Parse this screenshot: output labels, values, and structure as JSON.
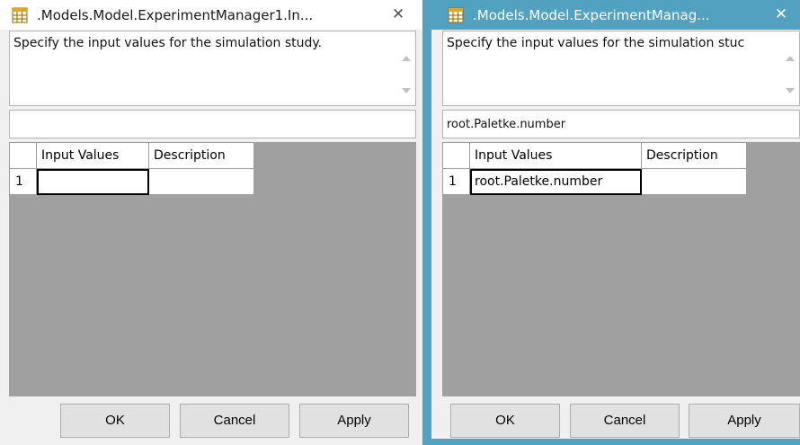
{
  "left_dialog": {
    "title": ".Models.Model.ExperimentManager1.In...",
    "description": "Specify the input values for the simulation study.",
    "input_value": "",
    "grid": {
      "headers": [
        "Input Values",
        "Description"
      ],
      "rows": [
        {
          "num": "1",
          "input_value": "",
          "description": ""
        }
      ]
    },
    "buttons": {
      "ok": "OK",
      "cancel": "Cancel",
      "apply": "Apply"
    }
  },
  "right_dialog": {
    "title": ".Models.Model.ExperimentManag...",
    "description": "Specify the input values for the simulation stuc",
    "input_value": "root.Paletke.number",
    "grid": {
      "headers": [
        "Input Values",
        "Description"
      ],
      "rows": [
        {
          "num": "1",
          "input_value": "root.Paletke.number",
          "description": ""
        }
      ]
    },
    "buttons": {
      "ok": "OK",
      "cancel": "Cancel",
      "apply": "Apply"
    }
  },
  "icons": {
    "app_icon": "table-window-icon",
    "close_icon": "close-icon",
    "scroll_up": "scroll-up-arrow-icon",
    "scroll_down": "scroll-down-arrow-icon"
  },
  "colors": {
    "active_title_bar": "#52a1c0",
    "inactive_title_bar": "#ffffff",
    "grid_background": "#a0a0a0",
    "button_face": "#e1e1e1"
  }
}
